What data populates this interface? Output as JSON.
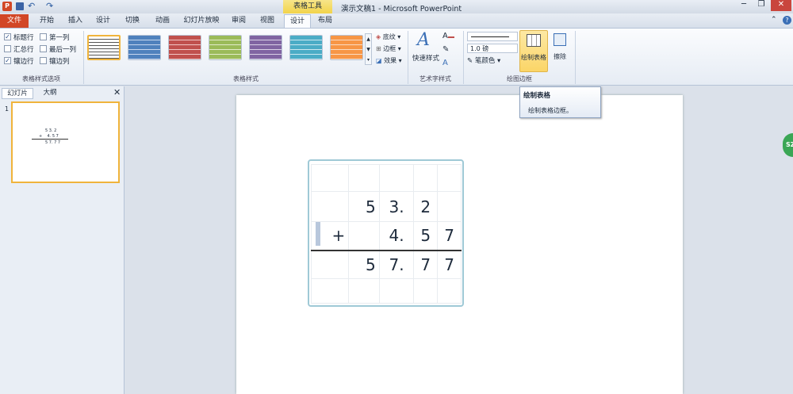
{
  "app": {
    "contextual_group": "表格工具",
    "window_title": "演示文稿1 - Microsoft PowerPoint",
    "colors": {
      "file_tab": "#d24726",
      "contextual": "#f2d44a",
      "green_badge": "#3aa655"
    },
    "badge_text": "SZ"
  },
  "tabs": [
    "文件",
    "开始",
    "插入",
    "设计",
    "切换",
    "动画",
    "幻灯片放映",
    "审阅",
    "视图",
    "设计",
    "布局"
  ],
  "active_tab": "设计",
  "options": {
    "header_row": "标题行",
    "first_column": "第一列",
    "total_row": "汇总行",
    "last_column": "最后一列",
    "banded_rows": "镶边行",
    "banded_columns": "镶边列",
    "group_label": "表格样式选项",
    "checked": [
      "标题行",
      "镶边行"
    ]
  },
  "styles": {
    "group_label": "表格样式",
    "shading": "底纹",
    "borders": "边框",
    "effects": "效果"
  },
  "wordart": {
    "quick_styles": "快速样式",
    "group_label": "艺术字样式"
  },
  "draw_borders": {
    "pen_weight": "1.0 磅",
    "pen_color": "笔颜色",
    "draw_table": "绘制表格",
    "eraser": "擦除",
    "group_label": "绘图边框"
  },
  "tooltip": {
    "title": "绘制表格",
    "body": "绘制表格边框。"
  },
  "panel": {
    "tab_slides": "幻灯片",
    "tab_outline": "大纲",
    "slide_number": "1"
  },
  "table": {
    "rows": [
      [
        "",
        "",
        "",
        "",
        ""
      ],
      [
        "",
        "5",
        "3.",
        "2",
        ""
      ],
      [
        "+",
        "",
        "4.",
        "5",
        "7"
      ],
      [
        "",
        "5",
        "7.",
        "7",
        "7"
      ]
    ]
  }
}
